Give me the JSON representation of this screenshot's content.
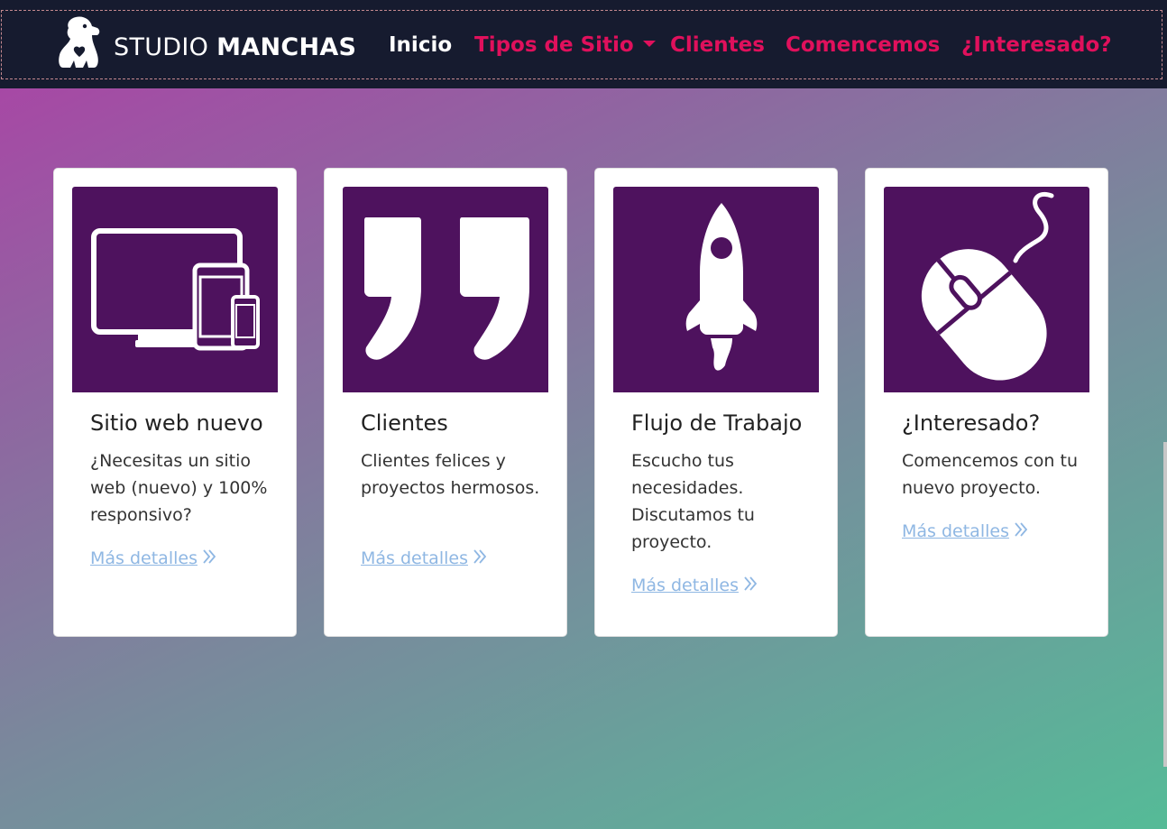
{
  "brand": {
    "light": "STUDIO",
    "bold": "MANCHAS",
    "logo_icon": "dog-heart-logo-icon"
  },
  "nav": {
    "items": [
      {
        "label": "Inicio",
        "active": true
      },
      {
        "label": "Tipos de Sitio",
        "dropdown": true
      },
      {
        "label": "Clientes"
      },
      {
        "label": "Comencemos"
      },
      {
        "label": "¿Interesado?"
      }
    ]
  },
  "cards": [
    {
      "icon": "devices-icon",
      "title": "Sitio web nuevo",
      "text": "¿Necesitas un sitio web (nuevo) y 100% responsivo?",
      "link": "Más detalles"
    },
    {
      "icon": "quote-icon",
      "title": "Clientes",
      "text": "Clientes felices y proyectos hermosos.",
      "link": "Más detalles"
    },
    {
      "icon": "rocket-icon",
      "title": "Flujo de Trabajo",
      "text": "Escucho tus necesidades. Discutamos tu proyecto.",
      "link": "Más detalles"
    },
    {
      "icon": "mouse-icon",
      "title": "¿Interesado?",
      "text": "Comencemos con tu nuevo proyecto.",
      "link": "Más detalles"
    }
  ],
  "colors": {
    "navbar_bg": "#161b2f",
    "nav_pink": "#e0105c",
    "card_image_bg": "#4e125e",
    "link_color": "#8fb7e3"
  }
}
